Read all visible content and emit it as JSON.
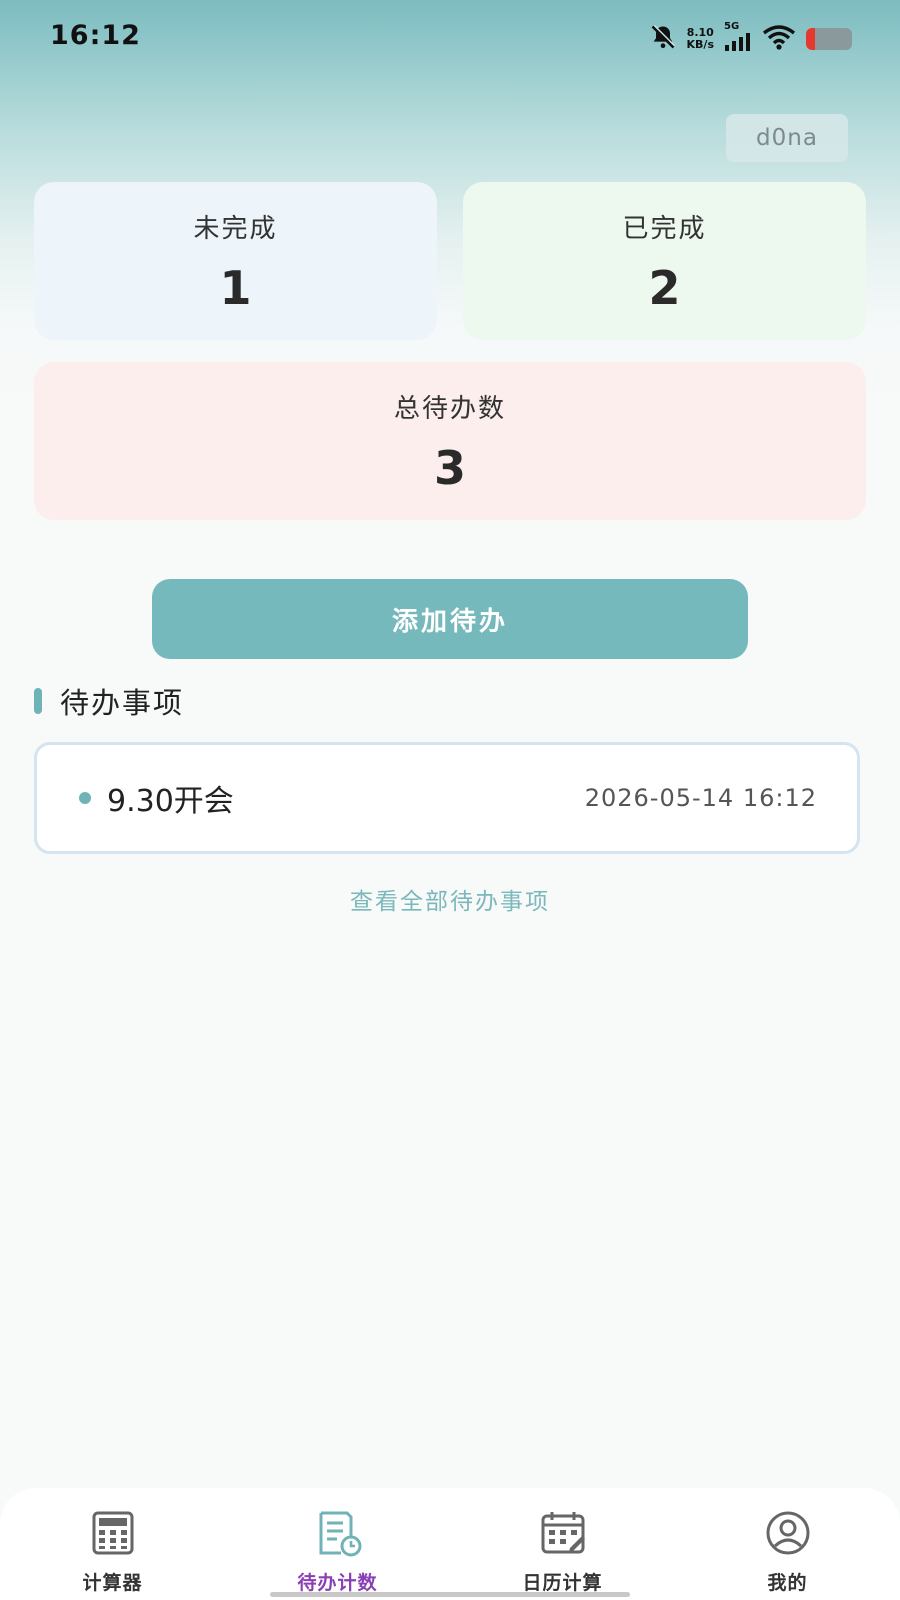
{
  "status_bar": {
    "time": "16:12",
    "net_speed_value": "8.10",
    "net_speed_unit": "KB/s",
    "network_type": "5G",
    "icons": [
      "bell-off-icon",
      "signal-icon",
      "wifi-icon",
      "battery-icon"
    ],
    "battery_color": "#e5392f"
  },
  "user": {
    "name": "d0na"
  },
  "stats": {
    "unfinished": {
      "label": "未完成",
      "value": "1"
    },
    "finished": {
      "label": "已完成",
      "value": "2"
    },
    "total": {
      "label": "总待办数",
      "value": "3"
    }
  },
  "add_button": {
    "label": "添加待办"
  },
  "section": {
    "title": "待办事项"
  },
  "todos": [
    {
      "title": "9.30开会",
      "time": "2026-05-14 16:12"
    }
  ],
  "view_all": {
    "label": "查看全部待办事项"
  },
  "bottom_nav": {
    "items": [
      {
        "label": "计算器",
        "icon": "calculator-icon"
      },
      {
        "label": "待办计数",
        "icon": "todo-list-icon",
        "active": true
      },
      {
        "label": "日历计算",
        "icon": "calendar-icon"
      },
      {
        "label": "我的",
        "icon": "user-profile-icon"
      }
    ]
  },
  "colors": {
    "accent": "#76b9bd",
    "active_tab": "#8a3fb5",
    "unfinished_card": "#edf4fa",
    "finished_card": "#edf8ef",
    "total_card": "#fbeeec"
  }
}
